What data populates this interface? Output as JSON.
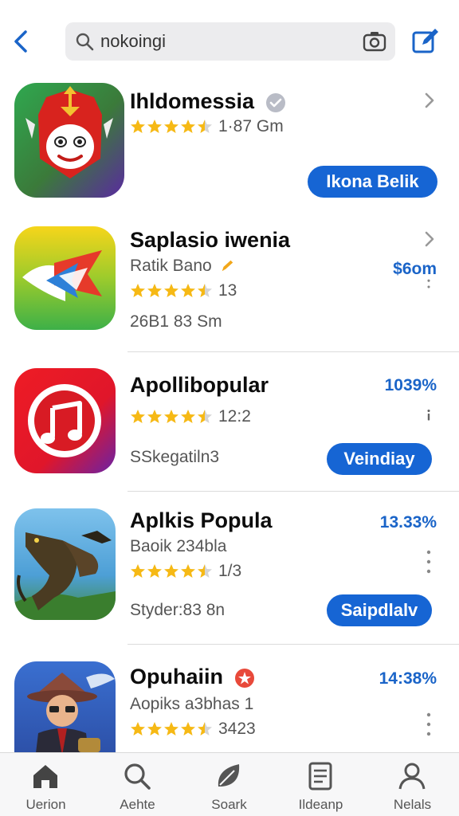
{
  "header": {
    "search_query": "nokoingi",
    "back_icon": "chevron-left-icon",
    "camera_icon": "camera-icon",
    "compose_icon": "compose-icon",
    "accent": "#1a64c8"
  },
  "apps": [
    {
      "name": "Ihldomessia",
      "rating_text": "1·87 Gm",
      "stars": 4.5,
      "button": "Ikona Belik",
      "badge": "verified-icon",
      "icon": "mask-face-icon"
    },
    {
      "name": "Saplasio iwenia",
      "subtitle": "Ratik Bano",
      "metric": "$6om",
      "stars": 4.5,
      "rating_text": "13",
      "meta": "26B1 83 Sm",
      "icon": "flag-arrow-icon"
    },
    {
      "name": "Apollibopular",
      "metric": "1039%",
      "stars": 4.5,
      "rating_text": "12:2",
      "meta": "SSkegatiln3",
      "button": "Veindiay",
      "icon": "music-note-icon"
    },
    {
      "name": "Aplkis Popula",
      "subtitle": "Baoik 234bla",
      "metric": "13.33%",
      "stars": 4.5,
      "rating_text": "1/3",
      "meta": "Styder:83 8n",
      "button": "Saipdlalv",
      "icon": "dragon-icon"
    },
    {
      "name": "Opuhaiin",
      "subtitle": "Aopiks a3bhas 1",
      "metric": "14:38%",
      "stars": 4.5,
      "rating_text": "3423",
      "badge": "star-badge-icon",
      "icon": "hat-character-icon"
    }
  ],
  "tabs": [
    {
      "label": "Uerion",
      "icon": "home-icon"
    },
    {
      "label": "Aehte",
      "icon": "search-icon"
    },
    {
      "label": "Soark",
      "icon": "leaf-icon"
    },
    {
      "label": "Ildeanp",
      "icon": "document-icon"
    },
    {
      "label": "Nelals",
      "icon": "person-icon"
    }
  ]
}
